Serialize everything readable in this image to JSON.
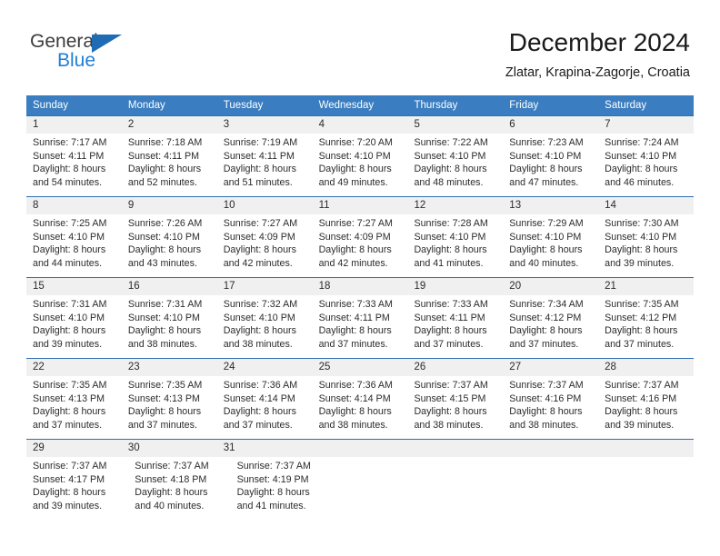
{
  "brand": {
    "name_top": "General",
    "name_bottom": "Blue",
    "triangle_color": "#1f6cb4",
    "blue_text_color": "#1f7fd4"
  },
  "header": {
    "title": "December 2024",
    "subtitle": "Zlatar, Krapina-Zagorje, Croatia"
  },
  "colors": {
    "header_row_bg": "#3a7dc0",
    "daynum_bg": "#f0f0f0",
    "week_divider": "#2f6fb0",
    "text": "#2b2b2b"
  },
  "weekdays": [
    "Sunday",
    "Monday",
    "Tuesday",
    "Wednesday",
    "Thursday",
    "Friday",
    "Saturday"
  ],
  "weeks": [
    {
      "days": [
        {
          "num": "1",
          "sunrise": "Sunrise: 7:17 AM",
          "sunset": "Sunset: 4:11 PM",
          "daylight1": "Daylight: 8 hours",
          "daylight2": "and 54 minutes."
        },
        {
          "num": "2",
          "sunrise": "Sunrise: 7:18 AM",
          "sunset": "Sunset: 4:11 PM",
          "daylight1": "Daylight: 8 hours",
          "daylight2": "and 52 minutes."
        },
        {
          "num": "3",
          "sunrise": "Sunrise: 7:19 AM",
          "sunset": "Sunset: 4:11 PM",
          "daylight1": "Daylight: 8 hours",
          "daylight2": "and 51 minutes."
        },
        {
          "num": "4",
          "sunrise": "Sunrise: 7:20 AM",
          "sunset": "Sunset: 4:10 PM",
          "daylight1": "Daylight: 8 hours",
          "daylight2": "and 49 minutes."
        },
        {
          "num": "5",
          "sunrise": "Sunrise: 7:22 AM",
          "sunset": "Sunset: 4:10 PM",
          "daylight1": "Daylight: 8 hours",
          "daylight2": "and 48 minutes."
        },
        {
          "num": "6",
          "sunrise": "Sunrise: 7:23 AM",
          "sunset": "Sunset: 4:10 PM",
          "daylight1": "Daylight: 8 hours",
          "daylight2": "and 47 minutes."
        },
        {
          "num": "7",
          "sunrise": "Sunrise: 7:24 AM",
          "sunset": "Sunset: 4:10 PM",
          "daylight1": "Daylight: 8 hours",
          "daylight2": "and 46 minutes."
        }
      ]
    },
    {
      "days": [
        {
          "num": "8",
          "sunrise": "Sunrise: 7:25 AM",
          "sunset": "Sunset: 4:10 PM",
          "daylight1": "Daylight: 8 hours",
          "daylight2": "and 44 minutes."
        },
        {
          "num": "9",
          "sunrise": "Sunrise: 7:26 AM",
          "sunset": "Sunset: 4:10 PM",
          "daylight1": "Daylight: 8 hours",
          "daylight2": "and 43 minutes."
        },
        {
          "num": "10",
          "sunrise": "Sunrise: 7:27 AM",
          "sunset": "Sunset: 4:09 PM",
          "daylight1": "Daylight: 8 hours",
          "daylight2": "and 42 minutes."
        },
        {
          "num": "11",
          "sunrise": "Sunrise: 7:27 AM",
          "sunset": "Sunset: 4:09 PM",
          "daylight1": "Daylight: 8 hours",
          "daylight2": "and 42 minutes."
        },
        {
          "num": "12",
          "sunrise": "Sunrise: 7:28 AM",
          "sunset": "Sunset: 4:10 PM",
          "daylight1": "Daylight: 8 hours",
          "daylight2": "and 41 minutes."
        },
        {
          "num": "13",
          "sunrise": "Sunrise: 7:29 AM",
          "sunset": "Sunset: 4:10 PM",
          "daylight1": "Daylight: 8 hours",
          "daylight2": "and 40 minutes."
        },
        {
          "num": "14",
          "sunrise": "Sunrise: 7:30 AM",
          "sunset": "Sunset: 4:10 PM",
          "daylight1": "Daylight: 8 hours",
          "daylight2": "and 39 minutes."
        }
      ]
    },
    {
      "days": [
        {
          "num": "15",
          "sunrise": "Sunrise: 7:31 AM",
          "sunset": "Sunset: 4:10 PM",
          "daylight1": "Daylight: 8 hours",
          "daylight2": "and 39 minutes."
        },
        {
          "num": "16",
          "sunrise": "Sunrise: 7:31 AM",
          "sunset": "Sunset: 4:10 PM",
          "daylight1": "Daylight: 8 hours",
          "daylight2": "and 38 minutes."
        },
        {
          "num": "17",
          "sunrise": "Sunrise: 7:32 AM",
          "sunset": "Sunset: 4:10 PM",
          "daylight1": "Daylight: 8 hours",
          "daylight2": "and 38 minutes."
        },
        {
          "num": "18",
          "sunrise": "Sunrise: 7:33 AM",
          "sunset": "Sunset: 4:11 PM",
          "daylight1": "Daylight: 8 hours",
          "daylight2": "and 37 minutes."
        },
        {
          "num": "19",
          "sunrise": "Sunrise: 7:33 AM",
          "sunset": "Sunset: 4:11 PM",
          "daylight1": "Daylight: 8 hours",
          "daylight2": "and 37 minutes."
        },
        {
          "num": "20",
          "sunrise": "Sunrise: 7:34 AM",
          "sunset": "Sunset: 4:12 PM",
          "daylight1": "Daylight: 8 hours",
          "daylight2": "and 37 minutes."
        },
        {
          "num": "21",
          "sunrise": "Sunrise: 7:35 AM",
          "sunset": "Sunset: 4:12 PM",
          "daylight1": "Daylight: 8 hours",
          "daylight2": "and 37 minutes."
        }
      ]
    },
    {
      "days": [
        {
          "num": "22",
          "sunrise": "Sunrise: 7:35 AM",
          "sunset": "Sunset: 4:13 PM",
          "daylight1": "Daylight: 8 hours",
          "daylight2": "and 37 minutes."
        },
        {
          "num": "23",
          "sunrise": "Sunrise: 7:35 AM",
          "sunset": "Sunset: 4:13 PM",
          "daylight1": "Daylight: 8 hours",
          "daylight2": "and 37 minutes."
        },
        {
          "num": "24",
          "sunrise": "Sunrise: 7:36 AM",
          "sunset": "Sunset: 4:14 PM",
          "daylight1": "Daylight: 8 hours",
          "daylight2": "and 37 minutes."
        },
        {
          "num": "25",
          "sunrise": "Sunrise: 7:36 AM",
          "sunset": "Sunset: 4:14 PM",
          "daylight1": "Daylight: 8 hours",
          "daylight2": "and 38 minutes."
        },
        {
          "num": "26",
          "sunrise": "Sunrise: 7:37 AM",
          "sunset": "Sunset: 4:15 PM",
          "daylight1": "Daylight: 8 hours",
          "daylight2": "and 38 minutes."
        },
        {
          "num": "27",
          "sunrise": "Sunrise: 7:37 AM",
          "sunset": "Sunset: 4:16 PM",
          "daylight1": "Daylight: 8 hours",
          "daylight2": "and 38 minutes."
        },
        {
          "num": "28",
          "sunrise": "Sunrise: 7:37 AM",
          "sunset": "Sunset: 4:16 PM",
          "daylight1": "Daylight: 8 hours",
          "daylight2": "and 39 minutes."
        }
      ]
    },
    {
      "days": [
        {
          "num": "29",
          "sunrise": "Sunrise: 7:37 AM",
          "sunset": "Sunset: 4:17 PM",
          "daylight1": "Daylight: 8 hours",
          "daylight2": "and 39 minutes."
        },
        {
          "num": "30",
          "sunrise": "Sunrise: 7:37 AM",
          "sunset": "Sunset: 4:18 PM",
          "daylight1": "Daylight: 8 hours",
          "daylight2": "and 40 minutes."
        },
        {
          "num": "31",
          "sunrise": "Sunrise: 7:37 AM",
          "sunset": "Sunset: 4:19 PM",
          "daylight1": "Daylight: 8 hours",
          "daylight2": "and 41 minutes."
        },
        {
          "num": "",
          "sunrise": "",
          "sunset": "",
          "daylight1": "",
          "daylight2": ""
        },
        {
          "num": "",
          "sunrise": "",
          "sunset": "",
          "daylight1": "",
          "daylight2": ""
        },
        {
          "num": "",
          "sunrise": "",
          "sunset": "",
          "daylight1": "",
          "daylight2": ""
        },
        {
          "num": "",
          "sunrise": "",
          "sunset": "",
          "daylight1": "",
          "daylight2": ""
        }
      ]
    }
  ]
}
